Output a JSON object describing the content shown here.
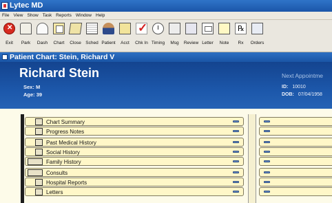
{
  "app": {
    "title": "Lytec MD"
  },
  "menu": [
    "File",
    "View",
    "Show",
    "Task",
    "Reports",
    "Window",
    "Help"
  ],
  "toolbar": [
    {
      "label": "Exit",
      "icon": "exit-icon"
    },
    {
      "label": "Park",
      "icon": "park-icon"
    },
    {
      "label": "Dash",
      "icon": "dashboard-icon"
    },
    {
      "label": "Chart",
      "icon": "chart-icon"
    },
    {
      "label": "Close",
      "icon": "close-chart-icon"
    },
    {
      "label": "Sched",
      "icon": "schedule-icon"
    },
    {
      "label": "Patient",
      "icon": "patient-icon"
    },
    {
      "label": "Acct",
      "icon": "account-icon"
    },
    {
      "label": "Chk In",
      "icon": "check-in-icon"
    },
    {
      "label": "Timing",
      "icon": "timing-icon"
    },
    {
      "label": "Msg",
      "icon": "message-icon"
    },
    {
      "label": "Review",
      "icon": "review-icon"
    },
    {
      "label": "Letter",
      "icon": "letter-icon"
    },
    {
      "label": "Note",
      "icon": "note-icon"
    },
    {
      "label": "Rx",
      "icon": "prescription-icon"
    },
    {
      "label": "Orders",
      "icon": "orders-icon"
    }
  ],
  "chart": {
    "title": "Patient Chart: Stein, Richard V"
  },
  "patient": {
    "name": "Richard Stein",
    "sex_label": "Sex:",
    "sex": "M",
    "age_label": "Age:",
    "age": "39",
    "next_appointment_label": "Next Appointme",
    "id_label": "ID:",
    "id": "10010",
    "dob_label": "DOB:",
    "dob": "07/04/1958"
  },
  "sections": [
    {
      "label": "Chart Summary",
      "icon": "chart-summary-icon"
    },
    {
      "label": "Progress Notes",
      "icon": "progress-notes-icon"
    },
    {
      "label": "Past Medical History",
      "icon": "medical-history-icon"
    },
    {
      "label": "Social History",
      "icon": "home-icon"
    },
    {
      "label": "Family History",
      "icon": "family-icon"
    },
    {
      "label": "Consults",
      "icon": "consults-icon"
    },
    {
      "label": "Hospital Reports",
      "icon": "hospital-reports-icon"
    },
    {
      "label": "Letters",
      "icon": "letters-icon"
    }
  ],
  "colors": {
    "titlebar": "#1b56a9",
    "header_bg": "#1c57aa",
    "drawer_bg": "#fff7c8",
    "toolbar_bg": "#eae7df"
  }
}
